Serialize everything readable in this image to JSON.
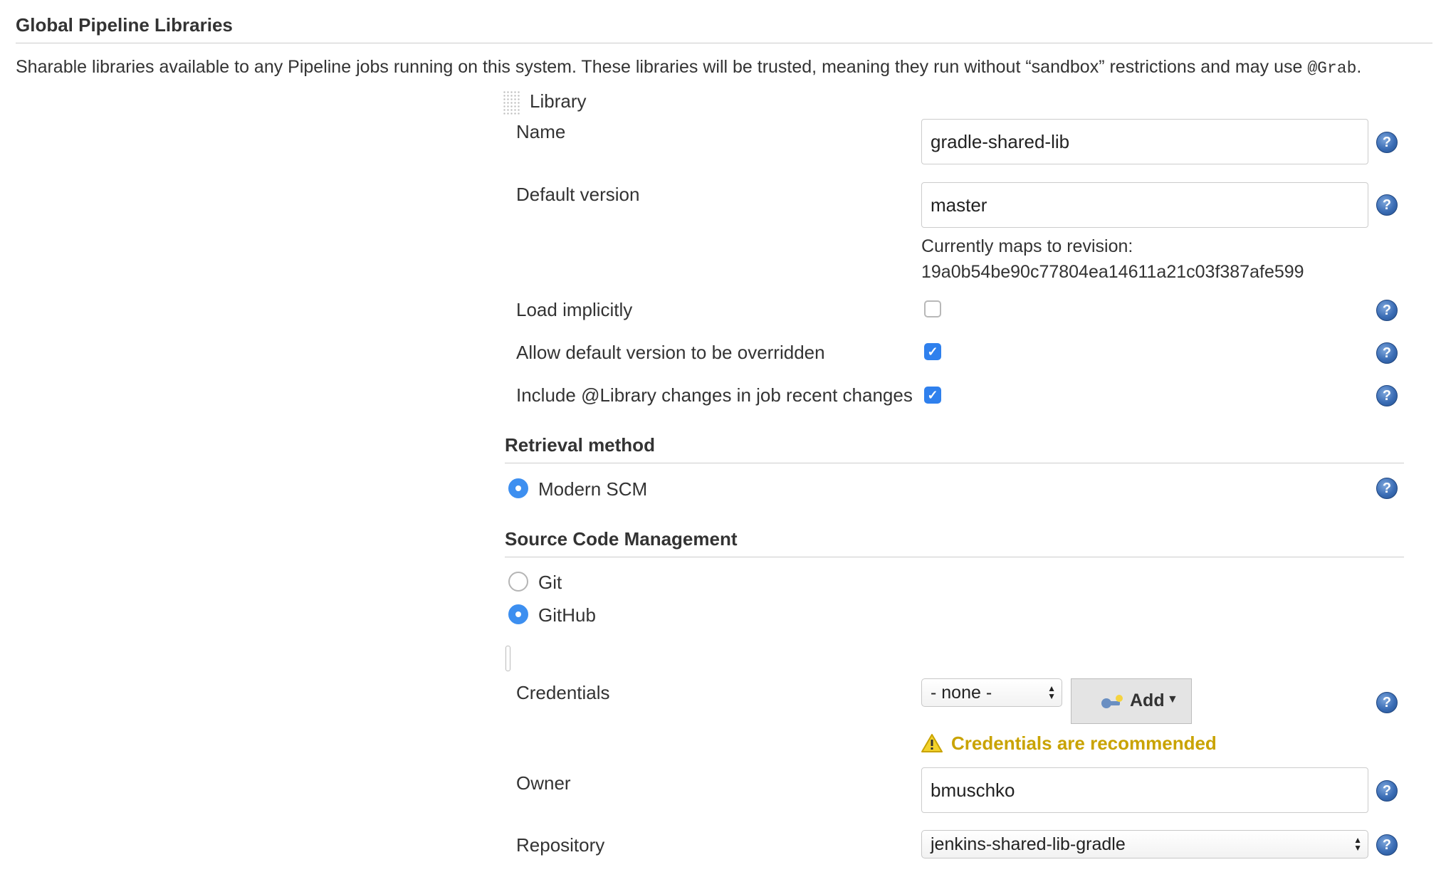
{
  "section": {
    "title": "Global Pipeline Libraries",
    "description_before": "Sharable libraries available to any Pipeline jobs running on this system. These libraries will be trusted, meaning they run without “sandbox” restrictions and may use ",
    "description_code": "@Grab",
    "description_after": "."
  },
  "library": {
    "header": "Library",
    "name_label": "Name",
    "name_value": "gradle-shared-lib",
    "default_version_label": "Default version",
    "default_version_value": "master",
    "revision_line1": "Currently maps to revision:",
    "revision_line2": "19a0b54be90c77804ea14611a21c03f387afe599",
    "load_implicitly_label": "Load implicitly",
    "load_implicitly_checked": false,
    "allow_override_label": "Allow default version to be overridden",
    "allow_override_checked": true,
    "include_changes_label": "Include @Library changes in job recent changes",
    "include_changes_checked": true
  },
  "retrieval": {
    "title": "Retrieval method",
    "options": [
      {
        "label": "Modern SCM",
        "selected": true
      }
    ]
  },
  "scm": {
    "title": "Source Code Management",
    "options": [
      {
        "label": "Git",
        "selected": false
      },
      {
        "label": "GitHub",
        "selected": true
      }
    ]
  },
  "github": {
    "credentials_label": "Credentials",
    "credentials_value": "- none -",
    "add_button_label": "Add",
    "credentials_warning": "Credentials are recommended",
    "owner_label": "Owner",
    "owner_value": "bmuschko",
    "repository_label": "Repository",
    "repository_value": "jenkins-shared-lib-gradle"
  },
  "icons": {
    "help": "help-icon",
    "drag_handle": "drag-handle-icon",
    "key": "key-icon",
    "warning": "warning-icon",
    "dropdown": "caret-down-icon",
    "select_arrows": "updown-arrows-icon"
  },
  "colors": {
    "accent_blue": "#2f80ed",
    "help_blue": "#3b6db5",
    "warning": "#c9a300"
  },
  "help_glyph": "?"
}
